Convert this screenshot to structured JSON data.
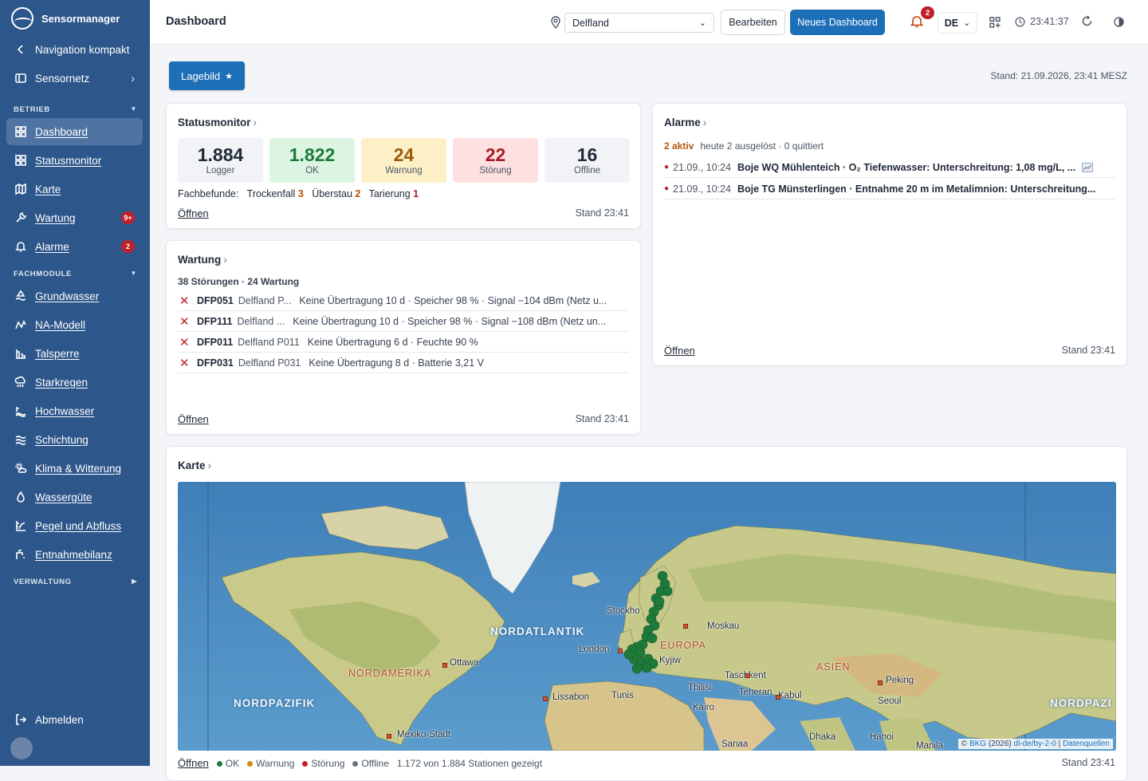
{
  "app": {
    "name": "Sensormanager"
  },
  "sidebar": {
    "nav_compact": "Navigation kompakt",
    "sensornetz": "Sensornetz",
    "section_betrieb": "BETRIEB",
    "betrieb": [
      {
        "label": "Dashboard",
        "icon": "dashboard-grid-icon"
      },
      {
        "label": "Statusmonitor",
        "icon": "grid-icon"
      },
      {
        "label": "Karte",
        "icon": "map-icon"
      },
      {
        "label": "Wartung",
        "icon": "wrench-icon",
        "badge": "9+"
      },
      {
        "label": "Alarme",
        "icon": "bell-icon",
        "badge": "2"
      }
    ],
    "section_fachmodule": "FACHMODULE",
    "fachmodule": [
      {
        "label": "Grundwasser",
        "icon": "groundwater-icon"
      },
      {
        "label": "NA-Modell",
        "icon": "graph-icon"
      },
      {
        "label": "Talsperre",
        "icon": "dam-icon"
      },
      {
        "label": "Starkregen",
        "icon": "heavy-rain-icon"
      },
      {
        "label": "Hochwasser",
        "icon": "flood-icon"
      },
      {
        "label": "Schichtung",
        "icon": "layers-waves-icon"
      },
      {
        "label": "Klima & Witterung",
        "icon": "sun-cloud-icon"
      },
      {
        "label": "Wassergüte",
        "icon": "drop-icon"
      },
      {
        "label": "Pegel und Abfluss",
        "icon": "gauge-icon"
      },
      {
        "label": "Entnahmebilanz",
        "icon": "tap-icon"
      }
    ],
    "section_verwaltung": "VERWALTUNG",
    "logout": "Abmelden"
  },
  "topbar": {
    "title": "Dashboard",
    "location": "Delfland",
    "edit": "Bearbeiten",
    "new_dashboard": "Neues Dashboard",
    "notif_count": "2",
    "language": "DE",
    "time": "23:41:37"
  },
  "main": {
    "tab": "Lagebild",
    "stand": "Stand: 21.09.2026, 23:41 MESZ"
  },
  "statusmonitor": {
    "title": "Statusmonitor",
    "kpis": [
      {
        "value": "1.884",
        "label": "Logger",
        "bg": "#f1f3f6",
        "color": "#1f2937"
      },
      {
        "value": "1.822",
        "label": "OK",
        "bg": "#dcf5e3",
        "color": "#1e7a3a"
      },
      {
        "value": "24",
        "label": "Warnung",
        "bg": "#fdf0c7",
        "color": "#9a5b0c"
      },
      {
        "value": "22",
        "label": "Störung",
        "bg": "#fde0e0",
        "color": "#a51d24"
      },
      {
        "value": "16",
        "label": "Offline",
        "bg": "#f1f3f6",
        "color": "#1f2937"
      }
    ],
    "fach_label": "Fachbefunde:",
    "fach": [
      {
        "name": "Trockenfall",
        "count": "3"
      },
      {
        "name": "Überstau",
        "count": "2"
      },
      {
        "name": "Tarierung",
        "count": "1"
      }
    ],
    "open": "Öffnen",
    "stand": "Stand 23:41"
  },
  "wartung": {
    "title": "Wartung",
    "summary": "38 Störungen · 24 Wartung",
    "rows": [
      {
        "id": "DFP051",
        "name": "Delfland P...",
        "desc": "Keine Übertragung 10 d · Speicher 98 % · Signal −104 dBm (Netz u..."
      },
      {
        "id": "DFP111",
        "name": "Delfland ...",
        "desc": "Keine Übertragung 10 d · Speicher 98 % · Signal −108 dBm (Netz un..."
      },
      {
        "id": "DFP011",
        "name": "Delfland P011",
        "desc": "Keine Übertragung 6 d · Feuchte 90 %"
      },
      {
        "id": "DFP031",
        "name": "Delfland P031",
        "desc": "Keine Übertragung 8 d · Batterie 3,21 V"
      }
    ],
    "open": "Öffnen",
    "stand": "Stand 23:41"
  },
  "alarme": {
    "title": "Alarme",
    "active": "2 aktiv",
    "summary": "heute 2 ausgelöst · 0 quittiert",
    "rows": [
      {
        "time": "21.09., 10:24",
        "desc": "Boje WQ Mühlenteich · O₂ Tiefenwasser: Unterschreitung: 1,08 mg/L, ..."
      },
      {
        "time": "21.09., 10:24",
        "desc": "Boje TG Münsterlingen · Entnahme 20 m im Metalimnion: Unterschreitung..."
      }
    ],
    "open": "Öffnen",
    "stand": "Stand 23:41"
  },
  "karte": {
    "title": "Karte",
    "labels": {
      "nordatlantik": "NORDATLANTIK",
      "nordpazifik": "NORDPAZIFIK",
      "nordpazifik2": "NORDPAZI",
      "nordamerika": "NORDAMERIKA",
      "europa": "EUROPA",
      "asien": "ASIEN"
    },
    "cities": {
      "stockholm": "Stockho",
      "moskau": "Moskau",
      "london": "London",
      "kyjiw": "Kyjiw",
      "ottawa": "Ottawa",
      "lissabon": "Lissabon",
      "tunis": "Tunis",
      "taschkent": "Taschkent",
      "tbilisi": "Tbilisi",
      "teheran": "Teheran",
      "kabul": "Kabul",
      "kairo": "Kairo",
      "peking": "Peking",
      "seoul": "Seoul",
      "mexiko": "Mexiko-Stadt",
      "sanaa": "Sanaa",
      "dhaka": "Dhaka",
      "hanoi": "Hanoi",
      "manila": "Manila"
    },
    "attribution_prefix": "© ",
    "attribution_bkg": "BKG",
    "attribution_mid": " (2026) ",
    "attribution_license": "dl-de/by-2-0",
    "attribution_sep": " | ",
    "attribution_sources": "Datenquellen",
    "open": "Öffnen",
    "legend": [
      {
        "label": "OK",
        "color": "#1e7a3a"
      },
      {
        "label": "Warnung",
        "color": "#d08a12"
      },
      {
        "label": "Störung",
        "color": "#c0202a"
      },
      {
        "label": "Offline",
        "color": "#6b7280"
      }
    ],
    "shown": "1.172 von 1.884 Stationen gezeigt",
    "stand": "Stand 23:41"
  }
}
